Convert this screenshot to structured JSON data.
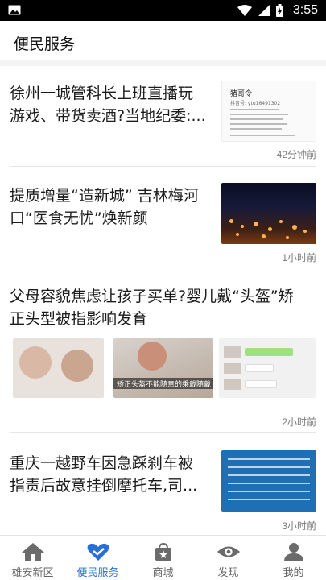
{
  "status_bar": {
    "time": "3:55"
  },
  "page": {
    "title": "便民服务"
  },
  "articles": [
    {
      "headline_line1": "徐州一城管科长上班直播玩",
      "headline_line2": "游戏、带货卖酒?当地纪委:...",
      "time": "42分钟前",
      "thumb_heading": "猪哥令",
      "thumb_sub": "抖音号: ytu16491302"
    },
    {
      "headline_line1": "提质增量“造新城” 吉林梅河",
      "headline_line2": "口“医食无忧”焕新颜",
      "time": "1小时前"
    },
    {
      "headline_line1": "父母容貌焦虑让孩子买单?婴儿戴“头盔”矫",
      "headline_line2": "正头型被指影响发育",
      "time": "2小时前",
      "image_caption": "矫正头盔不能随意的乘戴随戴"
    },
    {
      "headline_line1": "重庆一越野车因急踩刹车被",
      "headline_line2": "指责后故意挂倒摩托车,司...",
      "time": "3小时前"
    }
  ],
  "tabs": [
    {
      "label": "雄安新区",
      "icon": "home-icon"
    },
    {
      "label": "便民服务",
      "icon": "heart-service-icon",
      "active": true
    },
    {
      "label": "商城",
      "icon": "shop-bag-icon"
    },
    {
      "label": "发现",
      "icon": "eye-icon"
    },
    {
      "label": "我的",
      "icon": "person-icon"
    }
  ],
  "colors": {
    "accent": "#2a6fd6",
    "status_bar": "#000000"
  }
}
